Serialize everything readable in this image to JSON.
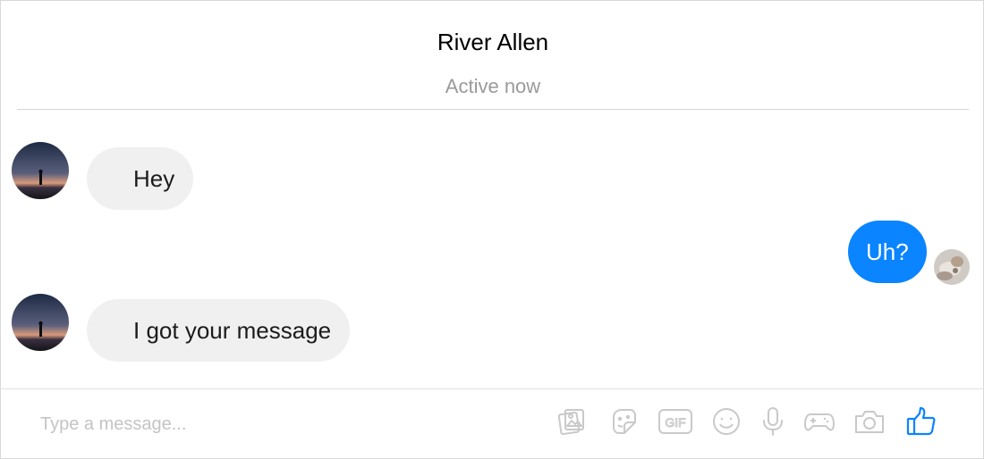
{
  "header": {
    "contact_name": "River Allen",
    "status": "Active now"
  },
  "messages": [
    {
      "direction": "incoming",
      "text": "Hey"
    },
    {
      "direction": "outgoing",
      "text": "Uh?"
    },
    {
      "direction": "incoming",
      "text": "I got your message"
    }
  ],
  "composer": {
    "placeholder": "Type a message...",
    "value": "",
    "icons": [
      "photo-icon",
      "sticker-icon",
      "gif-icon",
      "emoji-icon",
      "microphone-icon",
      "game-icon",
      "camera-icon",
      "thumbs-up-icon"
    ],
    "gif_label": "GIF"
  },
  "colors": {
    "accent": "#0a84ff",
    "incoming_bubble": "#f0f0f0",
    "icon_gray": "#c9c9c9"
  }
}
